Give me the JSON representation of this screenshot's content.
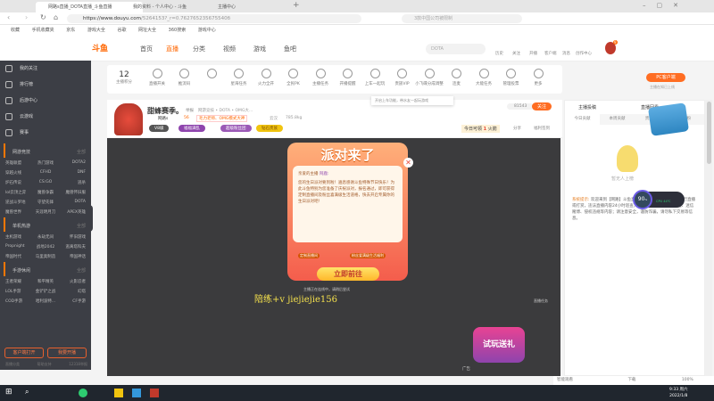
{
  "browser": {
    "tabs": [
      {
        "label": "网路s直播_DOTA直播_斗鱼直播"
      },
      {
        "label": "我的资料 - 个人中心 - 斗鱼"
      },
      {
        "label": "主播中心"
      }
    ],
    "url_domain": "https://www.douyu.com",
    "url_path": "/5264153?_r=0.762765235675540б",
    "search_placeholder": "3款中国公司被限制",
    "bookmarks": [
      "收藏",
      "手机收藏夹",
      "京东",
      "游戏大全",
      "谷歌",
      "网址大全",
      "360搜索",
      "游戏中心"
    ]
  },
  "site": {
    "logo": "斗鱼",
    "nav": [
      "首页",
      "直播",
      "分类",
      "视频",
      "游戏",
      "鱼吧"
    ],
    "search_placeholder": "DOTA",
    "header_icons": [
      "历史",
      "关注",
      "开播",
      "客户端",
      "消息",
      "创作中心"
    ],
    "badge_count": "9"
  },
  "sidebar": {
    "items": [
      "我的关注",
      "排行榜",
      "后游中心",
      "云游戏",
      "赛事"
    ],
    "sections": [
      {
        "title": "网游竞技",
        "more": "全部",
        "games": [
          "英雄联盟",
          "热门游戏",
          "DOTA2",
          "穿越火线",
          "CFHD",
          "DNF",
          "炉石传说",
          "CS:GO",
          "逃杀",
          "lol云顶之弈",
          "魔兽争霸",
          "魔兽怀旧服",
          "逆战斗罗地",
          "守望先锋",
          "DOTA",
          "魔兽世界",
          "天涯明月刀",
          "APEX英雄"
        ]
      },
      {
        "title": "单机热游",
        "more": "全部",
        "games": [
          "主机游戏",
          "永劫无间",
          "怀旧游戏",
          "Propnight",
          "战地2042",
          "逃离塔科夫",
          "帝国时代",
          "马里奥制造",
          "帝国神话"
        ]
      },
      {
        "title": "手游休闲",
        "more": "全部",
        "games": [
          "王者荣耀",
          "和平精英",
          "火影忍者",
          "LOL手游",
          "金铲铲之战",
          "幻塔",
          "COD手游",
          "哈利波特...",
          "CF手游"
        ]
      }
    ],
    "buttons": [
      "客户端打开",
      "我要开播"
    ],
    "footer": [
      "直播分类",
      "帮助支持",
      "12318举报"
    ]
  },
  "toolbar": {
    "score": "12",
    "score_label": "主播积分",
    "items": [
      "直播开关",
      "推流码",
      "",
      "星海任务",
      "火力全开",
      "全民PK",
      "主播任务",
      "开播提醒",
      "上车一起玩",
      "贵族VIP",
      "小飞碟分成调整",
      "连麦",
      "大能任务",
      "管理投票",
      "更多"
    ],
    "pc_button": "PC客户端",
    "pc_note": "主播在知已上线",
    "tooltip": "开启上车功能，带水友一起玩游戏"
  },
  "streamer": {
    "name": "甜蜂赛季。",
    "tag": "举报",
    "category": "网游竞技 • DOTA • OMG大...",
    "nickname": "网路s",
    "heat": "56",
    "slogan": "毛力老师、OMG模式大神",
    "location": "云汉",
    "weight": "785.8kg",
    "badges": [
      "V8级",
      "福福满乱",
      "超级粉丝团",
      "钻石贵族"
    ],
    "followers": "81543",
    "follow": "关注",
    "today": "今日可领",
    "today_value": "1",
    "today_unit": "火箭",
    "share": "分享",
    "report": "福利签到",
    "avatar_tags": [
      "关注",
      "分享"
    ]
  },
  "popup": {
    "title": "派对来了",
    "greeting": "亲爱的主播",
    "name": "阿鹿:",
    "body": "您的生日派对要到啦！遍息感谢斗鱼特殊节日快乐！为此斗鱼特别为您准备了庆祝派对，报名通过，即可获得定制直播间及粉丝喜满级生活道格，快去开启专属你的生日派对吧!",
    "reward1": "定制直播间",
    "reward2": "粉丝爱满级生活福利",
    "go": "立即前往",
    "note": "主播正在连线中，请稍后尝试"
  },
  "video": {
    "watermark": "陪练+v jiejiejie156",
    "ad": "广告",
    "promo": "试玩送礼",
    "top": "直播任务"
  },
  "right_panel": {
    "tabs": [
      "主播投稿",
      "直播回看"
    ],
    "rank_tabs": [
      "今日贡献",
      "本周贡献",
      "贵宾(9)",
      "钻粉"
    ],
    "empty": "暂无人上榜",
    "system_label": "系统提示:",
    "system_text": "欢迎来到【网路】斗鱼直播间！斗鱼严禁未成年人进行直播或打赏，违法直播内容24小时巡查，严禁低俗色情、暴力血腥、迷信赌博、侵权违规等内容；请注意安全，谨防诈骗，请勿私下交易等信息。",
    "gauge": "90",
    "gauge_unit": "%",
    "gpu": "CPU 44℃"
  },
  "status_bar": {
    "items": [
      "智能观看",
      "下载"
    ],
    "zoom": "100%"
  },
  "taskbar": {
    "time": "9:33 周六",
    "date": "2022/1/8"
  }
}
